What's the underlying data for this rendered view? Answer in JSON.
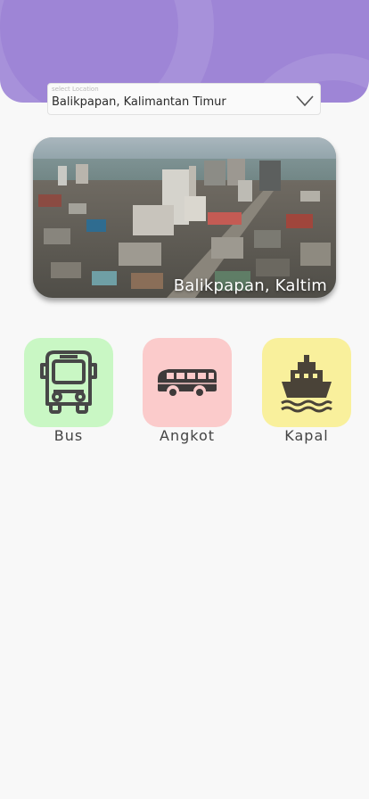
{
  "location": {
    "label": "select Location",
    "selected": "Balikpapan, Kalimantan Timur"
  },
  "city_card": {
    "caption": "Balikpapan, Kaltim"
  },
  "transports": [
    {
      "label": "Bus",
      "icon": "bus-icon",
      "color": "#c9f7c4"
    },
    {
      "label": "Angkot",
      "icon": "minivan-icon",
      "color": "#fbcbcb"
    },
    {
      "label": "Kapal",
      "icon": "ship-icon",
      "color": "#f9f09c"
    }
  ],
  "colors": {
    "header": "#9e85d6",
    "background": "#f8f8f8"
  }
}
